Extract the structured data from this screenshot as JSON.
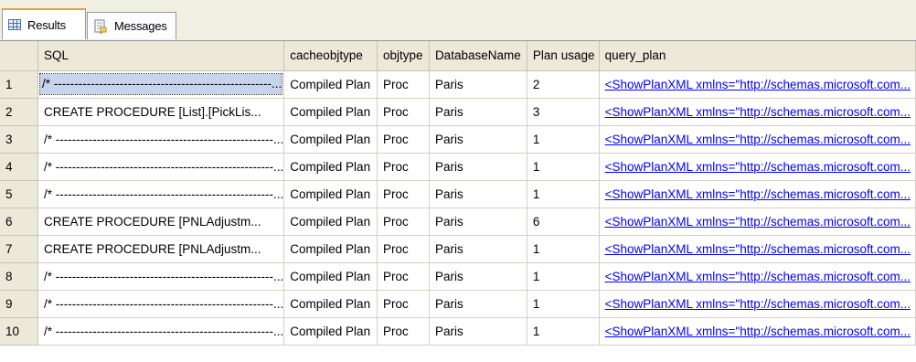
{
  "tabs": [
    {
      "label": "Results",
      "icon": "grid-icon"
    },
    {
      "label": "Messages",
      "icon": "messages-icon"
    }
  ],
  "columns": [
    "",
    "SQL",
    "cacheobjtype",
    "objtype",
    "DatabaseName",
    "Plan usage",
    "query_plan"
  ],
  "rows": [
    [
      "1",
      "/* -----------------------------------------------------...",
      "Compiled Plan",
      "Proc",
      "Paris",
      "2",
      "<ShowPlanXML xmlns=\"http://schemas.microsoft.com..."
    ],
    [
      "2",
      "CREATE PROCEDURE [List].[PickLis...",
      "Compiled Plan",
      "Proc",
      "Paris",
      "3",
      "<ShowPlanXML xmlns=\"http://schemas.microsoft.com..."
    ],
    [
      "3",
      "/* -----------------------------------------------------...",
      "Compiled Plan",
      "Proc",
      "Paris",
      "1",
      "<ShowPlanXML xmlns=\"http://schemas.microsoft.com..."
    ],
    [
      "4",
      "/* -----------------------------------------------------...",
      "Compiled Plan",
      "Proc",
      "Paris",
      "1",
      "<ShowPlanXML xmlns=\"http://schemas.microsoft.com..."
    ],
    [
      "5",
      "/* -----------------------------------------------------...",
      "Compiled Plan",
      "Proc",
      "Paris",
      "1",
      "<ShowPlanXML xmlns=\"http://schemas.microsoft.com..."
    ],
    [
      "6",
      "CREATE PROCEDURE [PNLAdjustm...",
      "Compiled Plan",
      "Proc",
      "Paris",
      "6",
      "<ShowPlanXML xmlns=\"http://schemas.microsoft.com..."
    ],
    [
      "7",
      "CREATE PROCEDURE [PNLAdjustm...",
      "Compiled Plan",
      "Proc",
      "Paris",
      "1",
      "<ShowPlanXML xmlns=\"http://schemas.microsoft.com..."
    ],
    [
      "8",
      "/* -----------------------------------------------------...",
      "Compiled Plan",
      "Proc",
      "Paris",
      "1",
      "<ShowPlanXML xmlns=\"http://schemas.microsoft.com..."
    ],
    [
      "9",
      "/* -----------------------------------------------------...",
      "Compiled Plan",
      "Proc",
      "Paris",
      "1",
      "<ShowPlanXML xmlns=\"http://schemas.microsoft.com..."
    ],
    [
      "10",
      "/* -----------------------------------------------------...",
      "Compiled Plan",
      "Proc",
      "Paris",
      "1",
      "<ShowPlanXML xmlns=\"http://schemas.microsoft.com..."
    ]
  ],
  "selected_row": 0,
  "colors": {
    "header_bg": "#ece9d8",
    "link": "#0000ff",
    "selection": "#c6d4ee",
    "active_tab_accent": "#e6a43c"
  }
}
